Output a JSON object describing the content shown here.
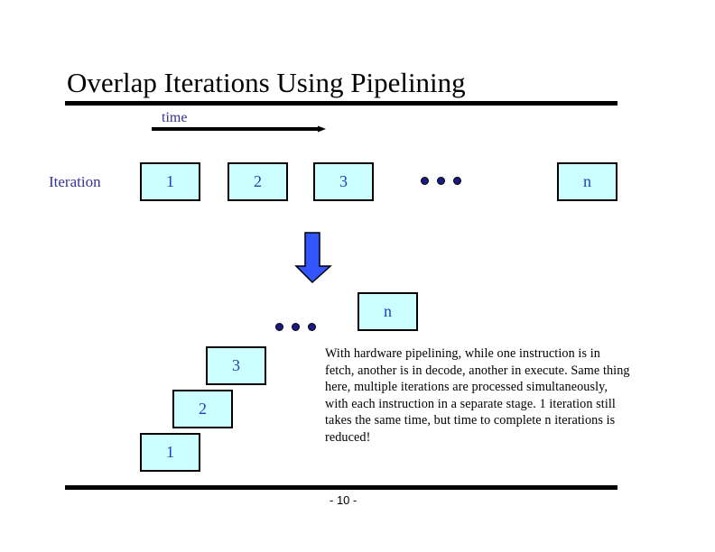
{
  "slide": {
    "title": "Overlap Iterations Using Pipelining",
    "time_label": "time",
    "iteration_label": "Iteration",
    "sequential_boxes": [
      "1",
      "2",
      "3",
      "n"
    ],
    "pipelined_boxes": [
      "1",
      "2",
      "3",
      "n"
    ],
    "ellipsis": "...",
    "description": "With hardware pipelining, while one instruction is in fetch, another is in decode, another in execute. Same thing here, multiple iterations are processed simultaneously, with each instruction in a separate stage.  1 iteration still takes the same time, but time to complete n iterations is reduced!",
    "page_number": "- 10 -"
  },
  "colors": {
    "box_fill": "#ccffff",
    "box_text": "#1f3fbf",
    "label_text": "#333399",
    "arrow_fill": "#3355ff",
    "dot_fill": "#1a1a80"
  }
}
